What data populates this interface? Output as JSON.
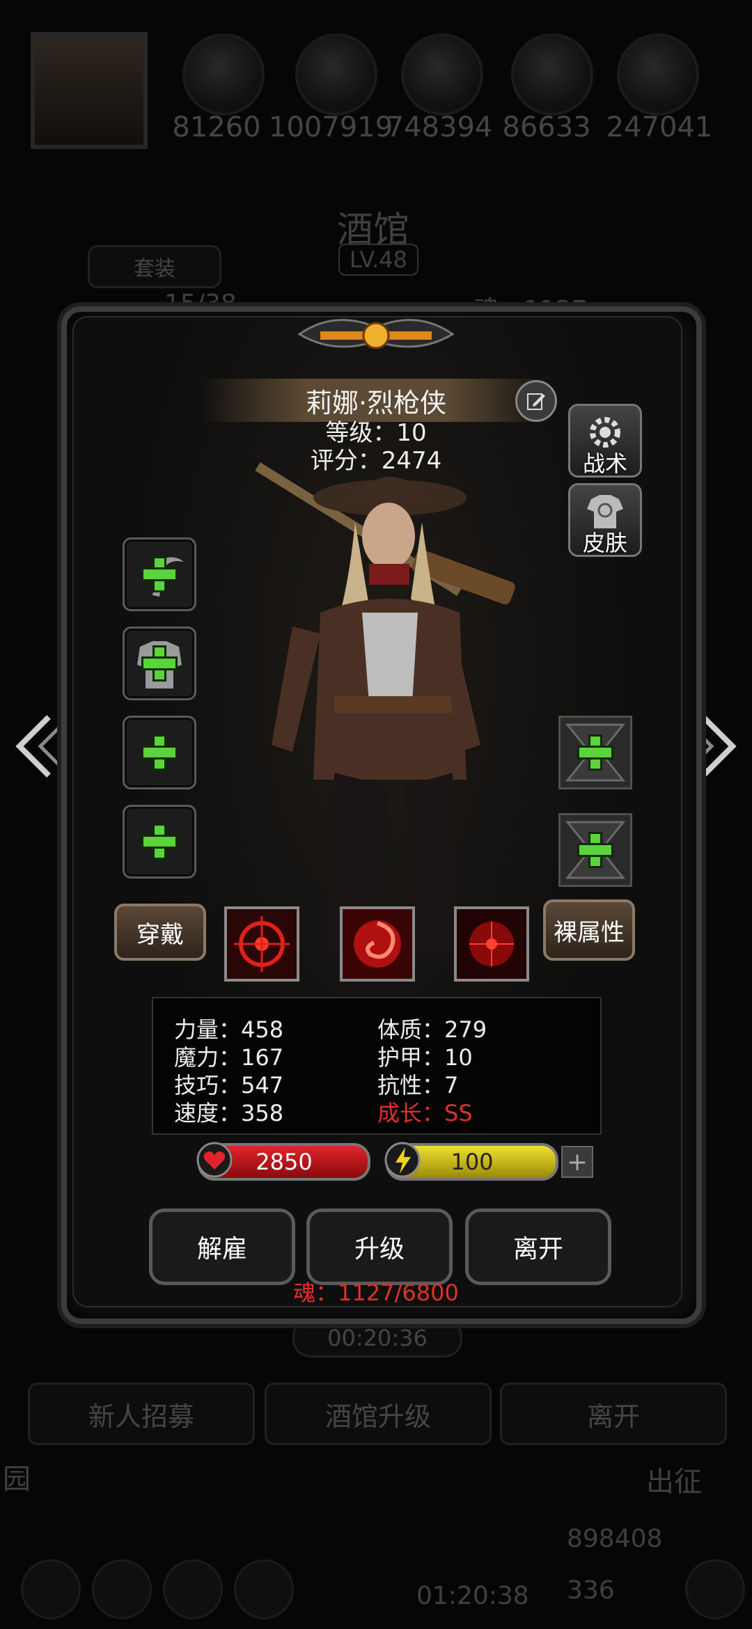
{
  "top_resources": {
    "values": [
      "81260",
      "1007919",
      "748394",
      "86633",
      "247041"
    ]
  },
  "background": {
    "title": "酒馆",
    "level_badge": "LV.48",
    "tab_label": "套装",
    "count_text": "15/38",
    "soul_text": "魂：1127",
    "timer": "00:20:36",
    "buttons": [
      "新人招募",
      "酒馆升级",
      "离开"
    ],
    "left_text": "园",
    "right_text": "出征",
    "gold": "898408",
    "gems": "336",
    "bottom_timer": "01:20:38"
  },
  "hero": {
    "name": "莉娜·烈枪侠",
    "level_text": "等级：10",
    "score_text": "评分：2474"
  },
  "side_buttons": {
    "tactics": "战术",
    "skin": "皮肤"
  },
  "equip": {
    "wear_label": "穿戴",
    "naked_label": "裸属性"
  },
  "stats": {
    "strength": "力量：458",
    "magic": "魔力：167",
    "skill": "技巧：547",
    "speed": "速度：358",
    "constitution": "体质：279",
    "armor": "护甲：10",
    "resistance": "抗性：7",
    "growth": "成长：SS"
  },
  "bars": {
    "hp": "2850",
    "energy": "100"
  },
  "actions": {
    "dismiss": "解雇",
    "upgrade": "升级",
    "leave": "离开"
  },
  "soul_cost": "魂：1127/6800",
  "colors": {
    "hp_red": "#c3141a",
    "energy_yellow": "#d6c51c",
    "plus_green": "#5bd33a",
    "growth_red": "#e0302a"
  }
}
